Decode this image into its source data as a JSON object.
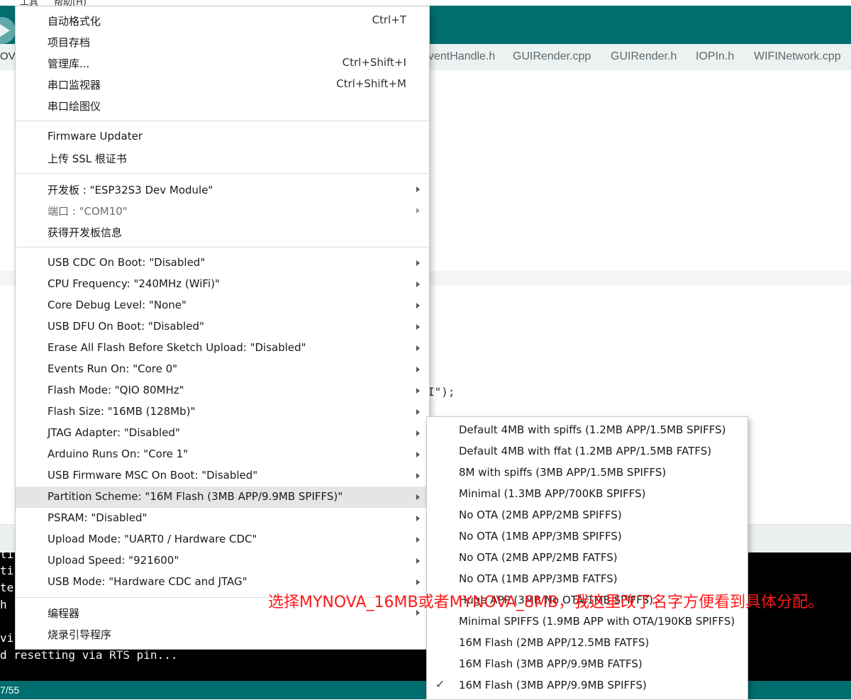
{
  "menubar": {
    "tools": "工具",
    "help": "帮助(H)"
  },
  "sketch_name": "OVA",
  "tabs": [
    "ventHandle.h",
    "GUIRender.cpp",
    "GUIRender.h",
    "IOPIn.h",
    "WIFINetwork.cpp"
  ],
  "editor": {
    "code_fragment": "I\");"
  },
  "console": {
    "lines": [
      "ti",
      "ti",
      "te",
      "h c",
      "",
      "vi",
      "d resetting via RTS pin..."
    ]
  },
  "status": {
    "text": "7/55"
  },
  "tools_menu": {
    "items": [
      {
        "label": "自动格式化",
        "shortcut": "Ctrl+T"
      },
      {
        "label": "项目存档"
      },
      {
        "label": "管理库...",
        "shortcut": "Ctrl+Shift+I"
      },
      {
        "label": "串口监视器",
        "shortcut": "Ctrl+Shift+M"
      },
      {
        "label": "串口绘图仪"
      },
      {
        "label": "Firmware Updater"
      },
      {
        "label": "上传 SSL 根证书"
      },
      {
        "label": "开发板 : \"ESP32S3 Dev Module\""
      },
      {
        "label": "端口 : \"COM10\""
      },
      {
        "label": "获得开发板信息"
      },
      {
        "label": "USB CDC On Boot: \"Disabled\""
      },
      {
        "label": "CPU Frequency: \"240MHz (WiFi)\""
      },
      {
        "label": "Core Debug Level: \"None\""
      },
      {
        "label": "USB DFU On Boot: \"Disabled\""
      },
      {
        "label": "Erase All Flash Before Sketch Upload: \"Disabled\""
      },
      {
        "label": "Events Run On: \"Core 0\""
      },
      {
        "label": "Flash Mode: \"QIO 80MHz\""
      },
      {
        "label": "Flash Size: \"16MB (128Mb)\""
      },
      {
        "label": "JTAG Adapter: \"Disabled\""
      },
      {
        "label": "Arduino Runs On: \"Core 1\""
      },
      {
        "label": "USB Firmware MSC On Boot: \"Disabled\""
      },
      {
        "label": "Partition Scheme: \"16M Flash (3MB APP/9.9MB SPIFFS)\""
      },
      {
        "label": "PSRAM: \"Disabled\""
      },
      {
        "label": "Upload Mode: \"UART0 / Hardware CDC\""
      },
      {
        "label": "Upload Speed: \"921600\""
      },
      {
        "label": "USB Mode: \"Hardware CDC and JTAG\""
      },
      {
        "label": "编程器"
      },
      {
        "label": "烧录引导程序"
      }
    ]
  },
  "partition_submenu": {
    "items": [
      "Default 4MB with spiffs (1.2MB APP/1.5MB SPIFFS)",
      "Default 4MB with ffat (1.2MB APP/1.5MB FATFS)",
      "8M with spiffs (3MB APP/1.5MB SPIFFS)",
      "Minimal (1.3MB APP/700KB SPIFFS)",
      "No OTA (2MB APP/2MB SPIFFS)",
      "No OTA (1MB APP/3MB SPIFFS)",
      "No OTA (2MB APP/2MB FATFS)",
      "No OTA (1MB APP/3MB FATFS)",
      "Huge APP (3MB No OTA/1MB SPIFFS)",
      "Minimal SPIFFS (1.9MB APP with OTA/190KB SPIFFS)",
      "16M Flash (2MB APP/12.5MB FATFS)",
      "16M Flash (3MB APP/9.9MB FATFS)",
      "16M Flash (3MB APP/9.9MB SPIFFS)"
    ],
    "selected_index": 12,
    "check_glyph": "✓"
  },
  "annotation": {
    "text": "选择MYNOVA_16MB或者MYNOVA_8MB，我这里改了名字方便看到具体分配。",
    "color": "#ff1a1a"
  },
  "colors": {
    "teal": "#006d6f",
    "highlight": "#e5e5e5"
  }
}
